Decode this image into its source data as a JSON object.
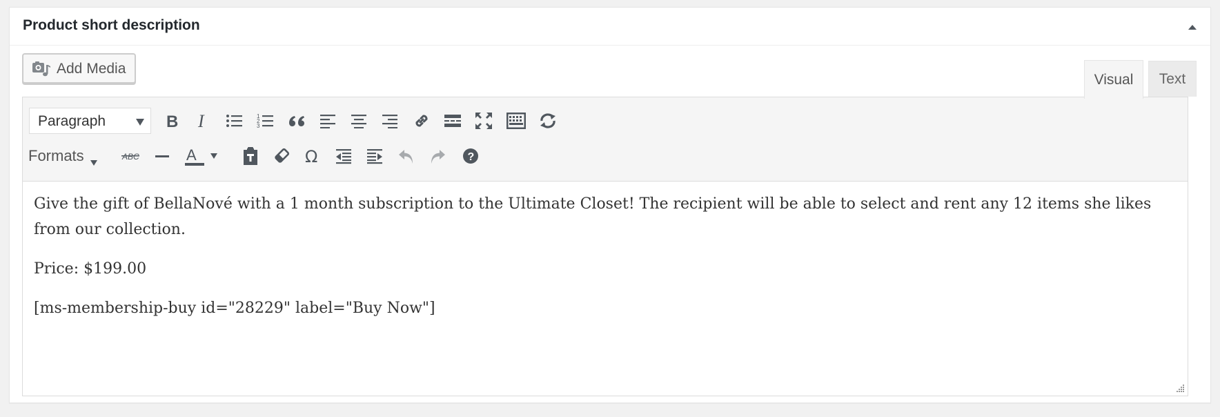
{
  "panel": {
    "title": "Product short description",
    "toggle_icon": "arrow-up-icon"
  },
  "add_media": {
    "label": "Add Media",
    "icon": "camera-music-icon"
  },
  "tabs": [
    {
      "label": "Visual",
      "active": true
    },
    {
      "label": "Text",
      "active": false
    }
  ],
  "toolbar": {
    "format_select": {
      "value": "Paragraph"
    },
    "row1": [
      "bold",
      "italic",
      "bulleted-list",
      "numbered-list",
      "blockquote",
      "align-left",
      "align-center",
      "align-right",
      "insert-link",
      "read-more",
      "fullscreen",
      "toolbar-toggle",
      "refresh"
    ],
    "formats_label": "Formats",
    "row2": [
      "strikethrough",
      "horizontal-line",
      "text-color",
      "paste-as-text",
      "clear-formatting",
      "special-character",
      "decrease-indent",
      "increase-indent",
      "undo",
      "redo",
      "help"
    ],
    "text_color_letter": "A",
    "strikethrough_text": "ABC",
    "help_symbol": "?",
    "omega_symbol": "Ω"
  },
  "content": {
    "paragraphs": [
      "Give the gift of BellaNové with a 1 month subscription to the Ultimate Closet! The recipient will be able to select and rent any 12 items she likes from our collection.",
      "Price: $199.00",
      "[ms-membership-buy id=\"28229\" label=\"Buy Now\"]"
    ]
  },
  "colors": {
    "icon": "#50575e",
    "disabled_icon": "#a7aaad",
    "toolbar_bg": "#f5f5f5",
    "border": "#dddddd"
  }
}
